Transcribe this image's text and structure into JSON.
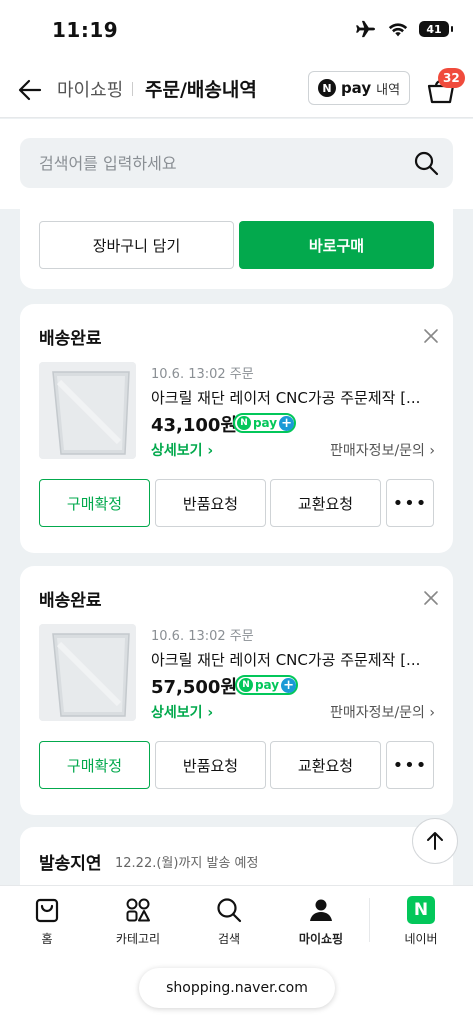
{
  "status_bar": {
    "time": "11:19",
    "battery": "41"
  },
  "header": {
    "breadcrumb": "마이쇼핑",
    "title": "주문/배송내역",
    "npay_n": "N",
    "npay_pay": "pay",
    "npay_history": "내역",
    "cart_count": "32"
  },
  "search": {
    "placeholder": "검색어를 입력하세요"
  },
  "top_actions": {
    "add_to_cart": "장바구니 담기",
    "buy_now": "바로구매"
  },
  "orders": [
    {
      "status": "배송완료",
      "date": "10.6. 13:02 주문",
      "product": "아크릴 재단 레이저 CNC가공 주문제작 [...",
      "price": "43,100원",
      "detail": "상세보기",
      "seller_info": "판매자정보/문의",
      "btn_confirm": "구매확정",
      "btn_return": "반품요청",
      "btn_exchange": "교환요청",
      "btn_more": "•••"
    },
    {
      "status": "배송완료",
      "date": "10.6. 13:02 주문",
      "product": "아크릴 재단 레이저 CNC가공 주문제작 [...",
      "price": "57,500원",
      "detail": "상세보기",
      "seller_info": "판매자정보/문의",
      "btn_confirm": "구매확정",
      "btn_return": "반품요청",
      "btn_exchange": "교환요청",
      "btn_more": "•••"
    }
  ],
  "delay": {
    "status": "발송지연",
    "eta": "12.22.(월)까지 발송 예정"
  },
  "badges": {
    "npay_n": "N",
    "npay_pay": "pay",
    "plus": "+"
  },
  "bottom_nav": {
    "home": "홈",
    "category": "카테고리",
    "search": "검색",
    "myshopping": "마이쇼핑",
    "naver": "네이버",
    "naver_logo": "N"
  },
  "url": "shopping.naver.com",
  "colors": {
    "green": "#03a94d",
    "badge_red": "#f04b3c",
    "npay_green": "#03c75a",
    "plus_blue": "#1a9ad6"
  }
}
